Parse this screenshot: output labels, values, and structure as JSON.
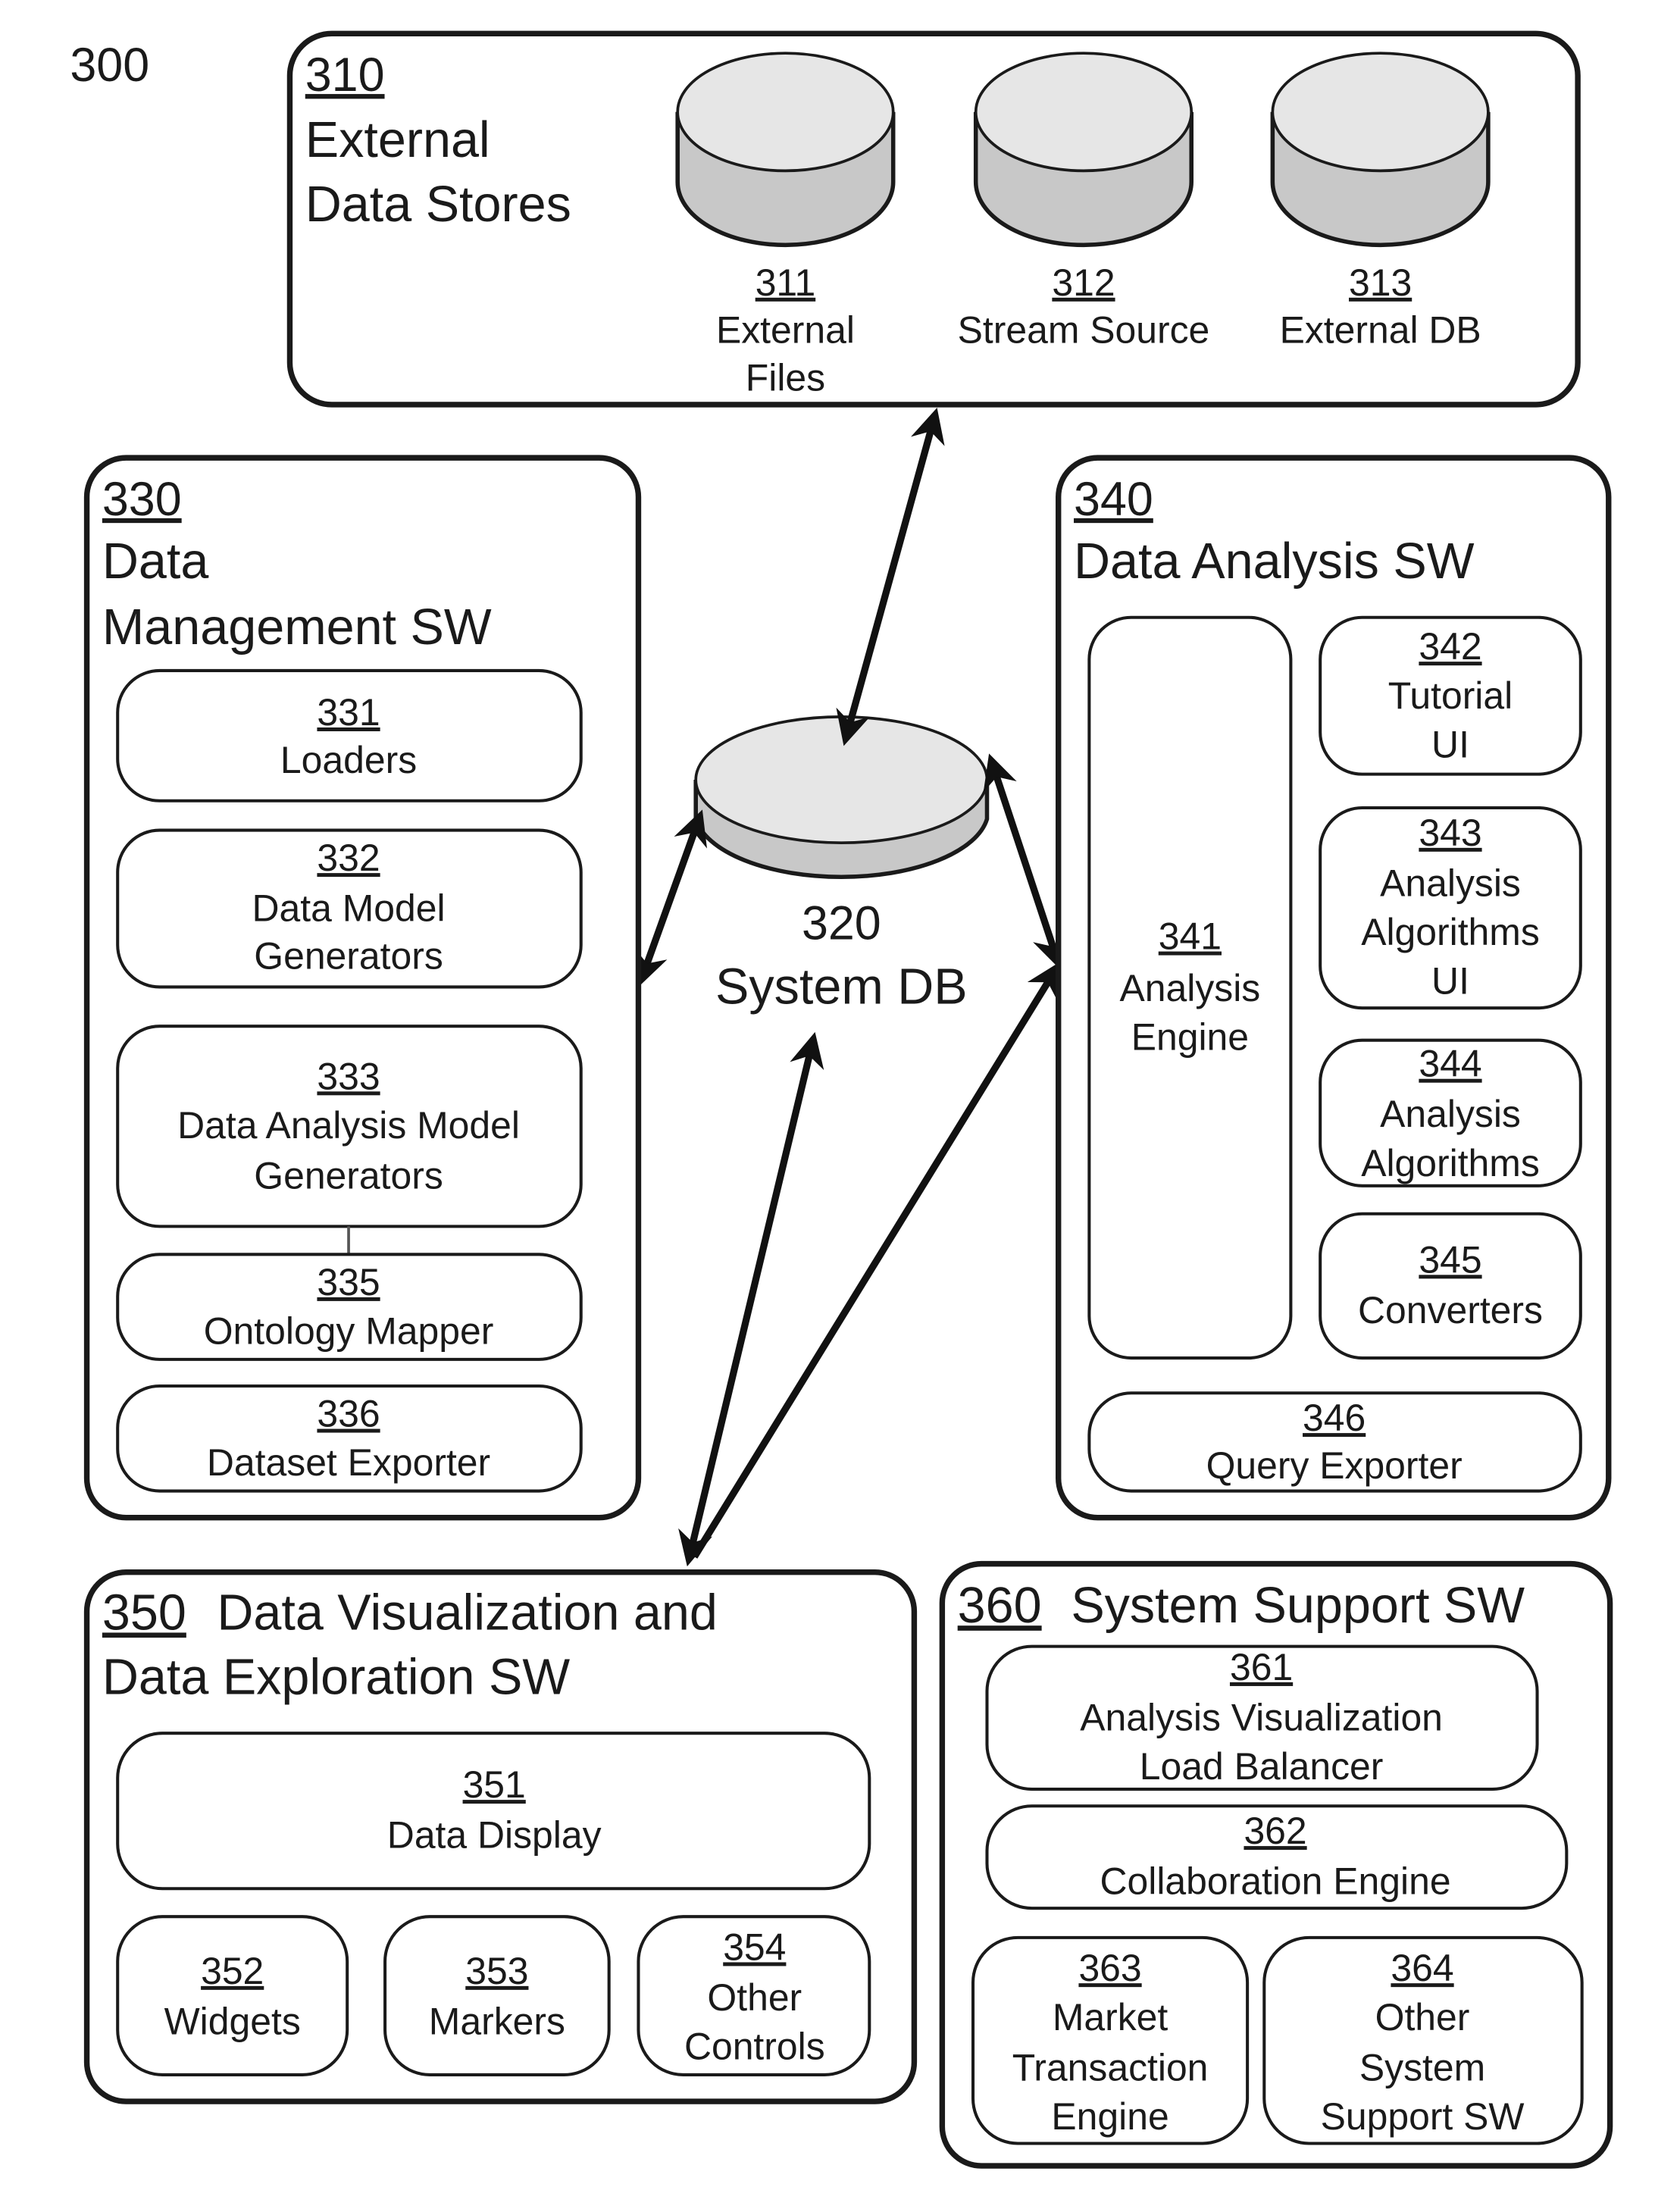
{
  "figure_label": "300",
  "external_data_stores": {
    "number": "310",
    "title_lines": [
      "External",
      "Data Stores"
    ],
    "stores": [
      {
        "number": "311",
        "label_lines": [
          "External",
          "Files"
        ]
      },
      {
        "number": "312",
        "label_lines": [
          "Stream Source"
        ]
      },
      {
        "number": "313",
        "label_lines": [
          "External DB"
        ]
      }
    ]
  },
  "system_db": {
    "number": "320",
    "label": "System DB"
  },
  "data_management": {
    "number": "330",
    "title_lines": [
      "Data",
      "Management SW"
    ],
    "items": [
      {
        "number": "331",
        "label_lines": [
          "Loaders"
        ]
      },
      {
        "number": "332",
        "label_lines": [
          "Data Model",
          "Generators"
        ]
      },
      {
        "number": "333",
        "label_lines": [
          "Data Analysis Model",
          "Generators"
        ]
      },
      {
        "number": "335",
        "label_lines": [
          "Ontology Mapper"
        ]
      },
      {
        "number": "336",
        "label_lines": [
          "Dataset Exporter"
        ]
      }
    ]
  },
  "data_analysis": {
    "number": "340",
    "title": "Data Analysis SW",
    "items": [
      {
        "number": "341",
        "label_lines": [
          "Analysis",
          "Engine"
        ]
      },
      {
        "number": "342",
        "label_lines": [
          "Tutorial",
          "UI"
        ]
      },
      {
        "number": "343",
        "label_lines": [
          "Analysis",
          "Algorithms",
          "UI"
        ]
      },
      {
        "number": "344",
        "label_lines": [
          "Analysis",
          "Algorithms"
        ]
      },
      {
        "number": "345",
        "label_lines": [
          "Converters"
        ]
      },
      {
        "number": "346",
        "label_lines": [
          "Query Exporter"
        ]
      }
    ]
  },
  "data_visualization": {
    "number": "350",
    "title_line1": "Data Visualization and",
    "title_line2": "Data Exploration SW",
    "items": [
      {
        "number": "351",
        "label_lines": [
          "Data Display"
        ]
      },
      {
        "number": "352",
        "label_lines": [
          "Widgets"
        ]
      },
      {
        "number": "353",
        "label_lines": [
          "Markers"
        ]
      },
      {
        "number": "354",
        "label_lines": [
          "Other",
          "Controls"
        ]
      }
    ]
  },
  "system_support": {
    "number": "360",
    "title": "System Support SW",
    "items": [
      {
        "number": "361",
        "label_lines": [
          "Analysis Visualization",
          "Load Balancer"
        ]
      },
      {
        "number": "362",
        "label_lines": [
          "Collaboration Engine"
        ]
      },
      {
        "number": "363",
        "label_lines": [
          "Market",
          "Transaction",
          "Engine"
        ]
      },
      {
        "number": "364",
        "label_lines": [
          "Other",
          "System",
          "Support SW"
        ]
      }
    ]
  }
}
